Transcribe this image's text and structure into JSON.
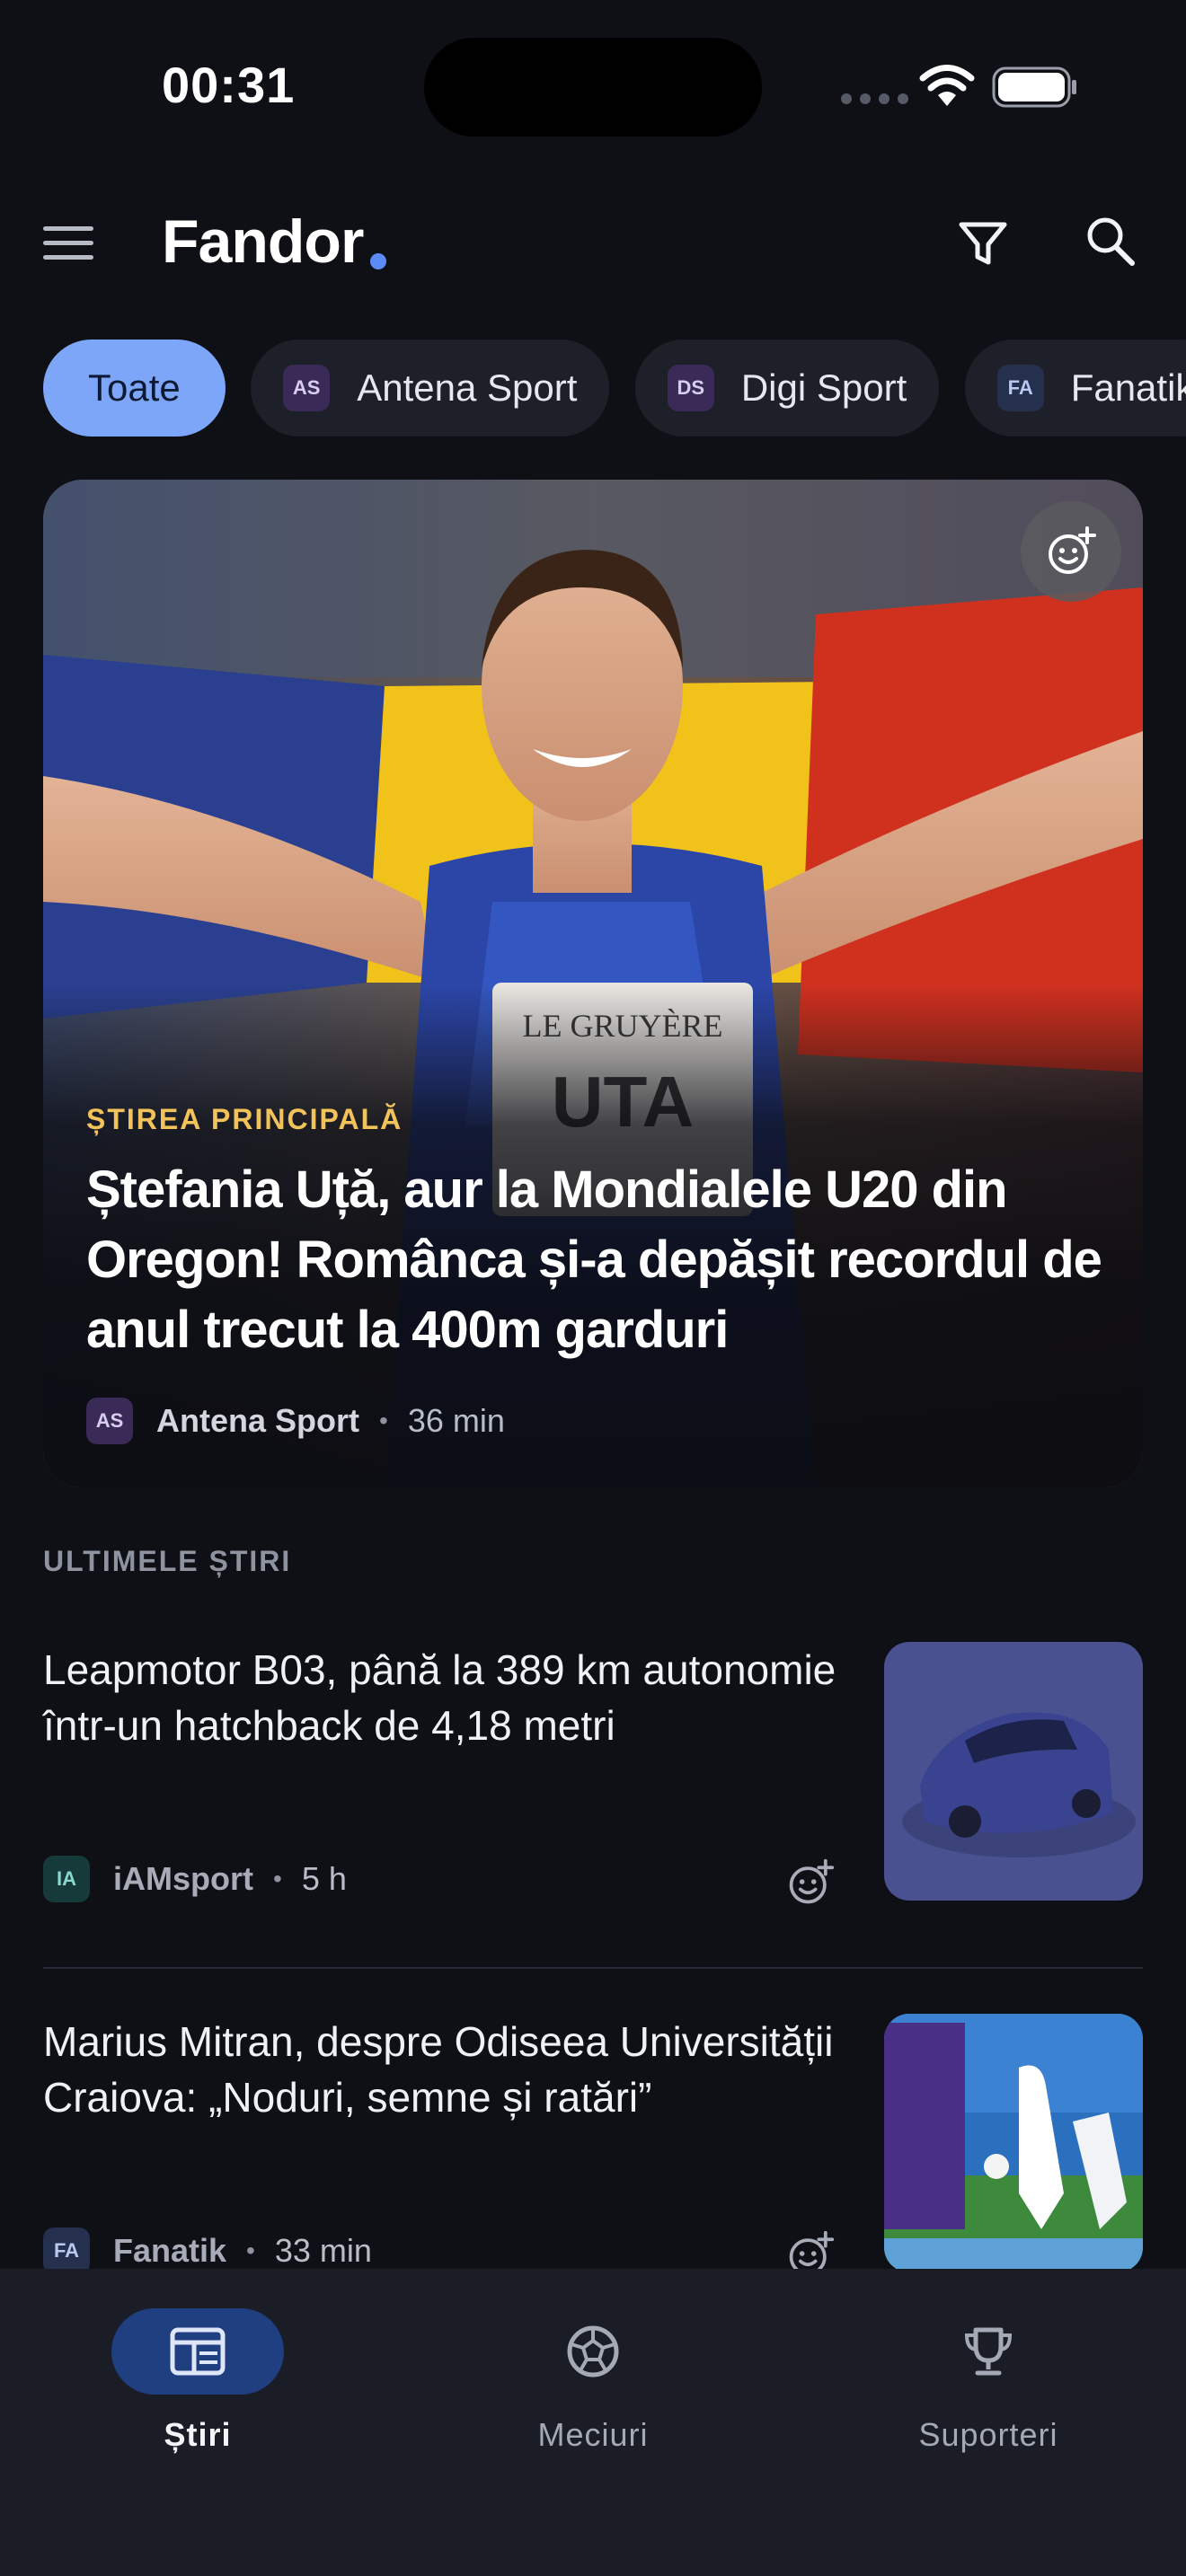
{
  "status_bar": {
    "time": "00:31",
    "icons": [
      "signal-icon",
      "wifi-icon",
      "battery-icon"
    ]
  },
  "header": {
    "brand": "Fandor",
    "brand_dot_color": "#5b8cf5",
    "icons": [
      "menu-icon",
      "filter-icon",
      "search-icon"
    ]
  },
  "chips": [
    {
      "label": "Toate",
      "active": true
    },
    {
      "badge": "AS",
      "label": "Antena Sport",
      "active": false
    },
    {
      "badge": "DS",
      "label": "Digi Sport",
      "active": false
    },
    {
      "badge": "FA",
      "label": "Fanatik",
      "active": false
    }
  ],
  "featured": {
    "kicker": "ȘTIREA PRINCIPALĂ",
    "title": "Ștefania Uță, aur la Mondialele U20 din Oregon! Românca și-a depășit recordul de anul trecut la 400m garduri",
    "source_badge": "AS",
    "source": "Antena Sport",
    "time": "36 min",
    "kicker_color": "#f2c25b"
  },
  "section": {
    "title": "ULTIMELE ȘTIRI"
  },
  "news": [
    {
      "title": "Leapmotor B03, până la 389 km autonomie într-un hatchback de 4,18 metri",
      "source_badge": "IA",
      "source": "iAMsport",
      "time": "5 h"
    },
    {
      "title": "Marius Mitran, despre Odiseea Universității Craiova: „Noduri, semne și ratări”",
      "source_badge": "FA",
      "source": "Fanatik",
      "time": "33 min"
    }
  ],
  "bottom_nav": [
    {
      "label": "Știri",
      "icon": "news-icon",
      "active": true
    },
    {
      "label": "Meciuri",
      "icon": "football-icon",
      "active": false
    },
    {
      "label": "Suporteri",
      "icon": "trophy-icon",
      "active": false
    }
  ],
  "colors": {
    "background": "#0e1016",
    "accent": "#7ea6f8",
    "nav_active": "#1f3f80"
  }
}
